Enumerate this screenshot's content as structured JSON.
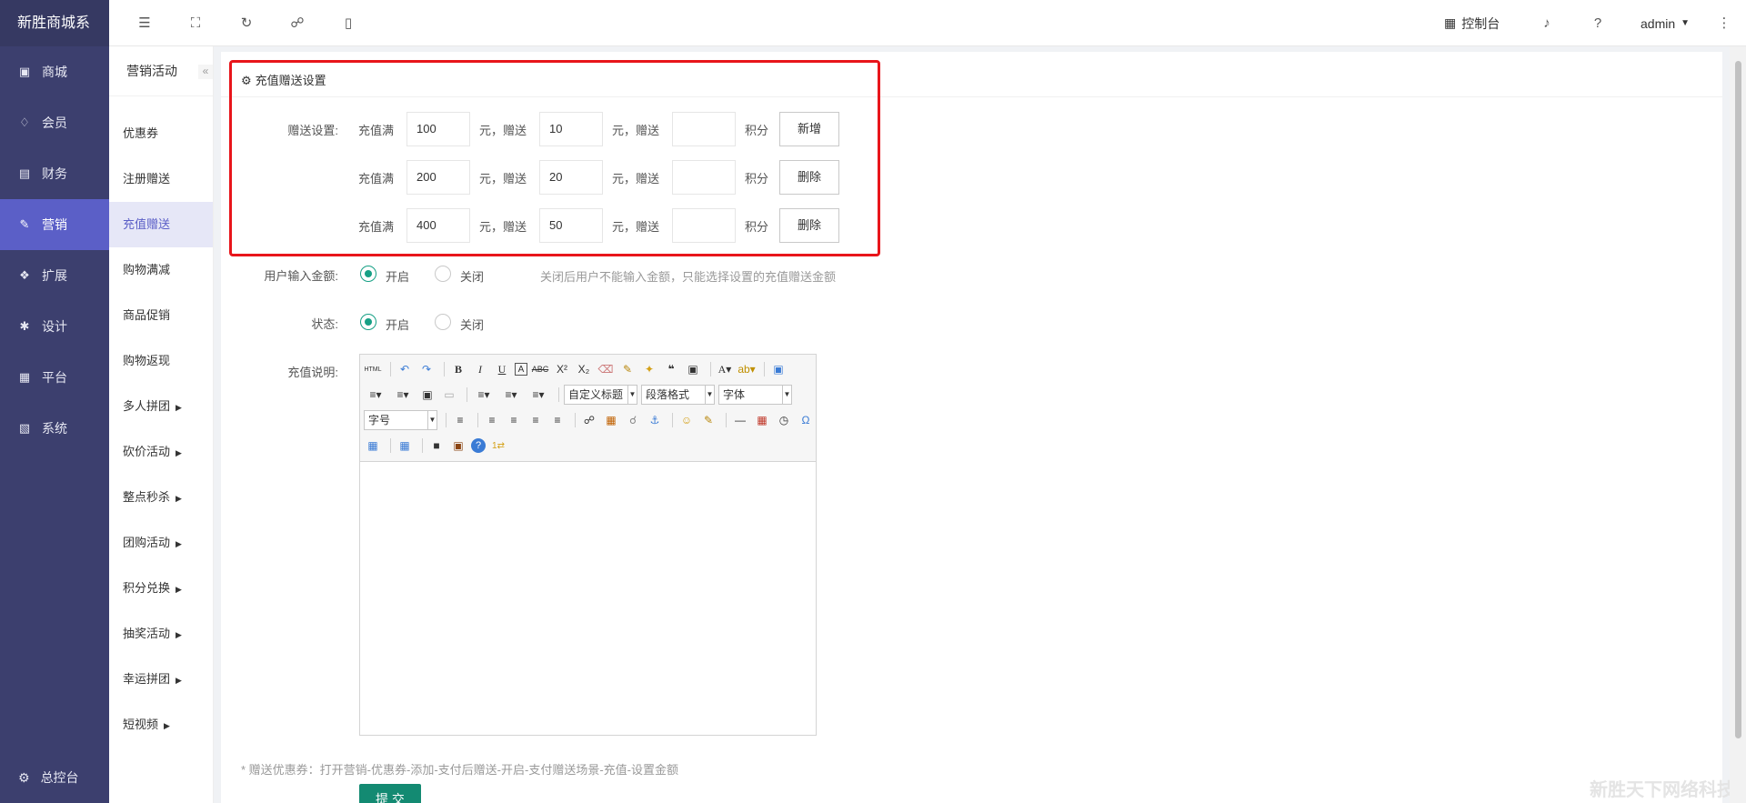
{
  "brand": "新胜商城系",
  "sidebar": {
    "items": [
      {
        "label": "商城",
        "icon": "shop-icon"
      },
      {
        "label": "会员",
        "icon": "member-icon"
      },
      {
        "label": "财务",
        "icon": "finance-icon"
      },
      {
        "label": "营销",
        "icon": "megaphone-icon"
      },
      {
        "label": "扩展",
        "icon": "cube-icon"
      },
      {
        "label": "设计",
        "icon": "puzzle-icon"
      },
      {
        "label": "平台",
        "icon": "grid-icon"
      },
      {
        "label": "系统",
        "icon": "monitor-icon"
      }
    ],
    "active": "营销",
    "bottom": "总控台"
  },
  "header": {
    "console": "控制台",
    "user": "admin"
  },
  "subnav": {
    "title": "营销活动",
    "collapse": "«",
    "items": [
      "优惠券",
      "注册赠送",
      "充值赠送",
      "购物满减",
      "商品促销",
      "购物返现",
      "多人拼团",
      "砍价活动",
      "整点秒杀",
      "团购活动",
      "积分兑换",
      "抽奖活动",
      "幸运拼团",
      "短视频"
    ],
    "active": "充值赠送"
  },
  "panel": {
    "title": "充值赠送设置"
  },
  "gift": {
    "label": "赠送设置:",
    "prefix": "充值满",
    "mid1": "元，赠送",
    "mid2": "元，赠送",
    "suffix": "积分",
    "rows": [
      {
        "amount": "100",
        "gift": "10",
        "points": "",
        "action": "新增"
      },
      {
        "amount": "200",
        "gift": "20",
        "points": "",
        "action": "删除"
      },
      {
        "amount": "400",
        "gift": "50",
        "points": "",
        "action": "删除"
      }
    ]
  },
  "user_input": {
    "label": "用户输入金额:",
    "on": "开启",
    "off": "关闭",
    "hint": "关闭后用户不能输入金额，只能选择设置的充值赠送金额"
  },
  "status": {
    "label": "状态:",
    "on": "开启",
    "off": "关闭"
  },
  "description": {
    "label": "充值说明:",
    "select_heading": "自定义标题",
    "select_paragraph": "段落格式",
    "select_font": "字体",
    "select_size": "字号"
  },
  "footnote": "* 赠送优惠券：打开营销-优惠券-添加-支付后赠送-开启-支付赠送场景-充值-设置金额",
  "submit": "提 交",
  "watermark": "新胜天下网络科技",
  "colors": {
    "sidebar": "#3c3f6e",
    "active": "#5b5fc7",
    "primary": "#16a085",
    "highlight": "#e8151b"
  }
}
